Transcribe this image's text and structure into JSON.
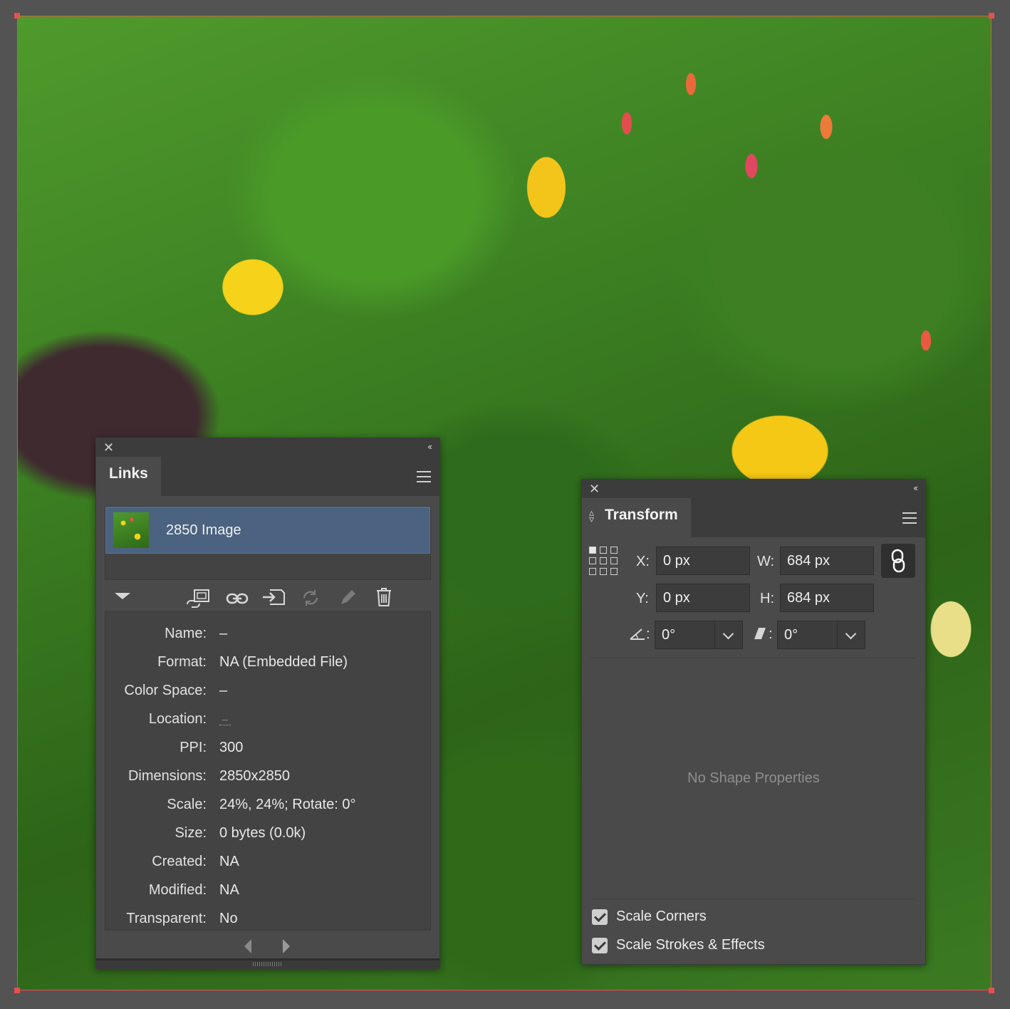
{
  "links_panel": {
    "close_glyph": "✕",
    "collapse_glyph": "‹‹",
    "tab_label": "Links",
    "selected_link": {
      "name": "2850 Image"
    },
    "info": [
      {
        "label": "Name:",
        "value": "–"
      },
      {
        "label": "Format:",
        "value": "NA (Embedded File)"
      },
      {
        "label": "Color Space:",
        "value": "–"
      },
      {
        "label": "Location:",
        "value": "–"
      },
      {
        "label": "PPI:",
        "value": "300"
      },
      {
        "label": "Dimensions:",
        "value": "2850x2850"
      },
      {
        "label": "Scale:",
        "value": "24%, 24%; Rotate: 0°"
      },
      {
        "label": "Size:",
        "value": "0 bytes (0.0k)"
      },
      {
        "label": "Created:",
        "value": "NA"
      },
      {
        "label": "Modified:",
        "value": "NA"
      },
      {
        "label": "Transparent:",
        "value": "No"
      }
    ],
    "toolbar_icons": [
      "relink-from-libraries-icon",
      "relink-icon",
      "go-to-link-icon",
      "update-link-icon",
      "edit-original-icon",
      "delete-icon"
    ]
  },
  "transform_panel": {
    "close_glyph": "✕",
    "collapse_glyph": "‹‹",
    "tab_label": "Transform",
    "x_label": "X:",
    "x_value": "0 px",
    "y_label": "Y:",
    "y_value": "0 px",
    "w_label": "W:",
    "w_value": "684 px",
    "h_label": "H:",
    "h_value": "684 px",
    "rotate_label": ":",
    "rotate_value": "0°",
    "shear_label": ":",
    "shear_value": "0°",
    "no_shape_text": "No Shape Properties",
    "scale_corners_label": "Scale Corners",
    "scale_strokes_label": "Scale Strokes & Effects",
    "scale_corners_checked": true,
    "scale_strokes_checked": true
  },
  "colors": {
    "artboard_border": "#e8504f",
    "selected_row": "#4b6280",
    "panel_bg": "#4a4a4a"
  }
}
